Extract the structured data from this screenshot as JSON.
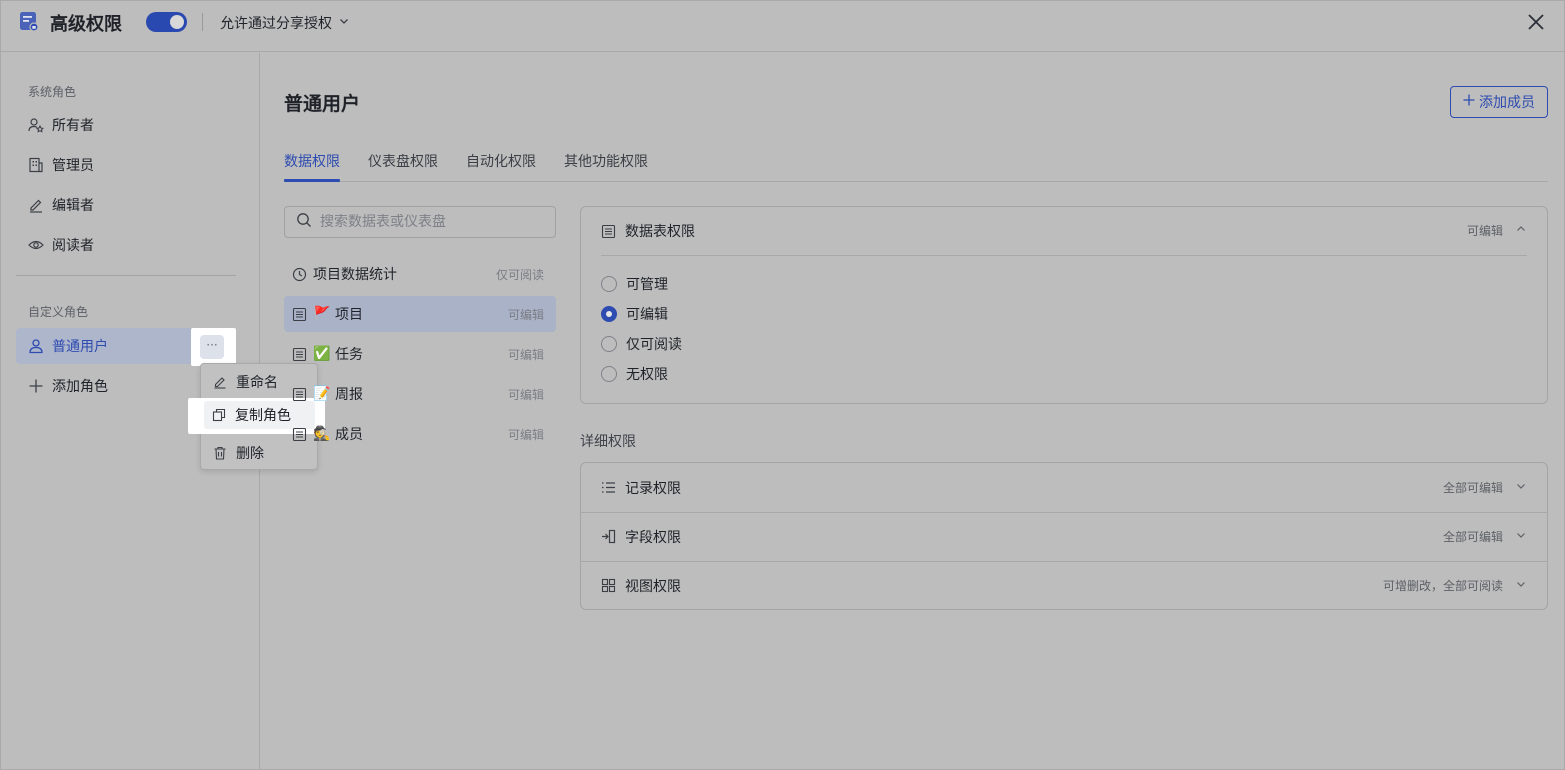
{
  "header": {
    "title": "高级权限",
    "toggle_on": true,
    "share_option": "允许通过分享授权"
  },
  "sidebar": {
    "system_label": "系统角色",
    "system_roles": [
      {
        "label": "所有者",
        "icon": "owner-icon"
      },
      {
        "label": "管理员",
        "icon": "admin-icon"
      },
      {
        "label": "编辑者",
        "icon": "edit-icon"
      },
      {
        "label": "阅读者",
        "icon": "eye-icon"
      }
    ],
    "custom_label": "自定义角色",
    "custom_roles": [
      {
        "label": "普通用户",
        "icon": "user-icon",
        "active": true
      }
    ],
    "add_role": "添加角色",
    "more_glyph": "···"
  },
  "context_menu": {
    "items": [
      {
        "label": "重命名",
        "icon": "rename-icon"
      },
      {
        "label": "复制角色",
        "icon": "copy-icon",
        "highlighted": true
      },
      {
        "label": "删除",
        "icon": "trash-icon"
      }
    ]
  },
  "main": {
    "title": "普通用户",
    "add_member": "添加成员",
    "tabs": [
      {
        "label": "数据权限",
        "active": true
      },
      {
        "label": "仪表盘权限"
      },
      {
        "label": "自动化权限"
      },
      {
        "label": "其他功能权限"
      }
    ],
    "search_placeholder": "搜索数据表或仪表盘",
    "datasources": [
      {
        "label": "项目数据统计",
        "emoji": "",
        "perm": "仅可阅读",
        "icon": "dashboard-icon"
      },
      {
        "label": "项目",
        "emoji": "🚩",
        "perm": "可编辑",
        "icon": "table-icon",
        "active": true
      },
      {
        "label": "任务",
        "emoji": "✅",
        "perm": "可编辑",
        "icon": "table-icon"
      },
      {
        "label": "周报",
        "emoji": "📝",
        "perm": "可编辑",
        "icon": "table-icon"
      },
      {
        "label": "成员",
        "emoji": "🕵",
        "perm": "可编辑",
        "icon": "table-icon"
      }
    ],
    "table_perm": {
      "title": "数据表权限",
      "current": "可编辑",
      "options": [
        {
          "label": "可管理",
          "checked": false
        },
        {
          "label": "可编辑",
          "checked": true
        },
        {
          "label": "仅可阅读",
          "checked": false
        },
        {
          "label": "无权限",
          "checked": false
        }
      ]
    },
    "detail_label": "详细权限",
    "details": [
      {
        "label": "记录权限",
        "value": "全部可编辑",
        "icon": "list-icon"
      },
      {
        "label": "字段权限",
        "value": "全部可编辑",
        "icon": "field-icon"
      },
      {
        "label": "视图权限",
        "value": "可增删改，全部可阅读",
        "icon": "grid-icon"
      }
    ]
  },
  "colors": {
    "accent": "#2d4bb0",
    "overlay": "#bdbdbd"
  }
}
